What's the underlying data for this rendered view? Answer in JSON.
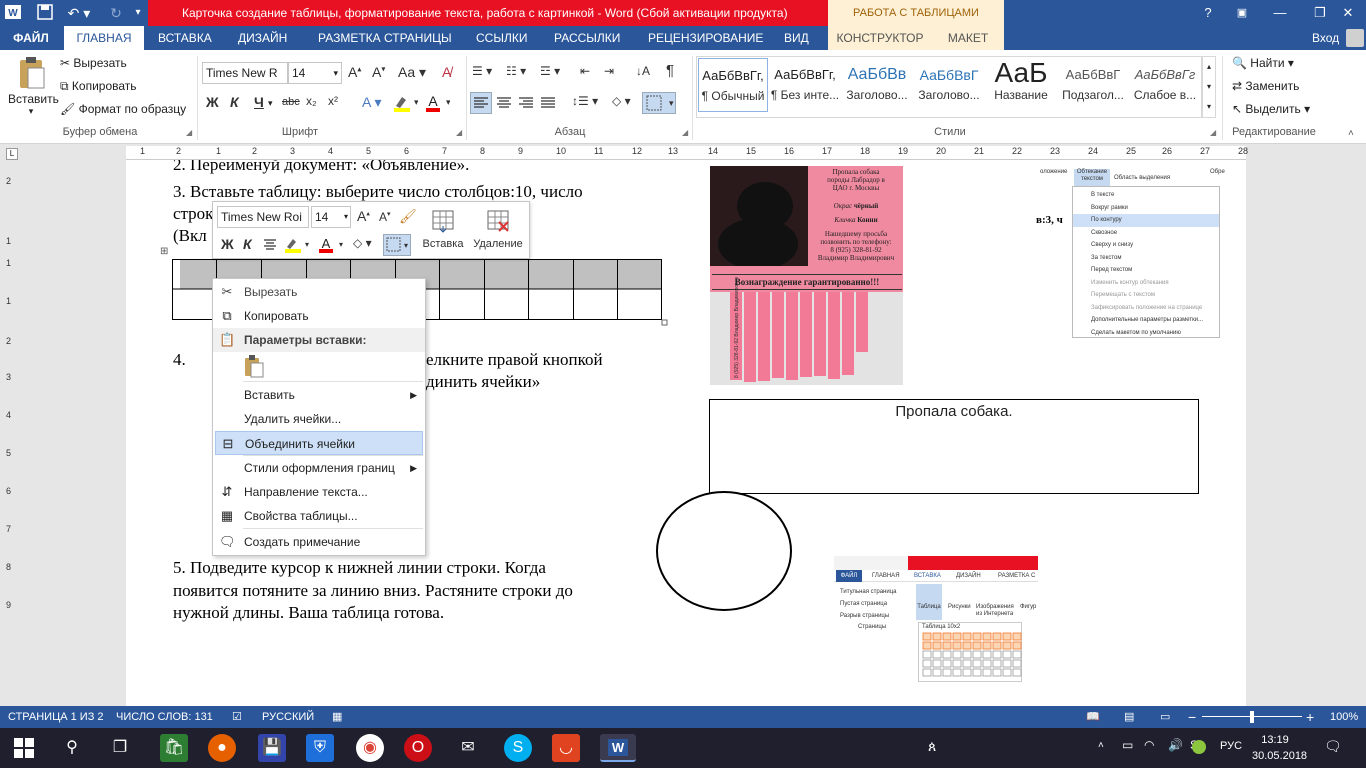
{
  "window": {
    "title": "Карточка создание таблицы, форматирование текста, работа с картинкой -  Word (Сбой активации продукта)",
    "context_tab_group": "РАБОТА С ТАБЛИЦАМИ",
    "login": "Вход",
    "help": "?",
    "minimize": "—",
    "restore": "❐",
    "close": "✕"
  },
  "tabs": [
    "ФАЙЛ",
    "ГЛАВНАЯ",
    "ВСТАВКА",
    "ДИЗАЙН",
    "РАЗМЕТКА СТРАНИЦЫ",
    "ССЫЛКИ",
    "РАССЫЛКИ",
    "РЕЦЕНЗИРОВАНИЕ",
    "ВИД",
    "КОНСТРУКТОР",
    "МАКЕТ"
  ],
  "ribbon": {
    "clipboard": {
      "paste": "Вставить",
      "cut": "Вырезать",
      "copy": "Копировать",
      "format_painter": "Формат по образцу",
      "label": "Буфер обмена"
    },
    "font": {
      "name": "Times New R",
      "size": "14",
      "label": "Шрифт",
      "case": "Aa",
      "bold": "Ж",
      "italic": "К",
      "underline": "Ч",
      "strike": "abc",
      "subscript": "x₂",
      "superscript": "x²"
    },
    "paragraph": {
      "label": "Абзац"
    },
    "styles": {
      "label": "Стили",
      "items": [
        {
          "preview": "АаБбВвГг,",
          "name": "¶ Обычный"
        },
        {
          "preview": "АаБбВвГг,",
          "name": "¶ Без инте..."
        },
        {
          "preview": "АаБбВв",
          "name": "Заголово..."
        },
        {
          "preview": "АаБбВвГ",
          "name": "Заголово..."
        },
        {
          "preview": "АаБ",
          "name": "Название"
        },
        {
          "preview": "АаБбВвГ",
          "name": "Подзагол..."
        },
        {
          "preview": "АаБбВвГг",
          "name": "Слабое в..."
        }
      ]
    },
    "editing": {
      "find": "Найти",
      "replace": "Заменить",
      "select": "Выделить",
      "label": "Редактирование"
    }
  },
  "ruler_numbers": [
    "1",
    "2",
    "1",
    "2",
    "3",
    "4",
    "5",
    "6",
    "7",
    "8",
    "9",
    "10",
    "11",
    "12",
    "13",
    "14",
    "15",
    "16",
    "17",
    "18",
    "19",
    "20",
    "21",
    "22",
    "23",
    "24",
    "25",
    "26",
    "27",
    "28"
  ],
  "vruler_numbers": [
    "2",
    "1",
    "1",
    "1",
    "2",
    "3",
    "4",
    "5",
    "6",
    "7",
    "8",
    "9"
  ],
  "document": {
    "line2": "2.       Переименуй документ: «Объявление».",
    "line3a": "3.       Вставьте таблицу: выберите число столбцов:10, число",
    "line3b": "строк",
    "line3c": "(Вкл",
    "line4a": "4.",
    "line4b": "елкните правой кнопкой",
    "line4c": "динить ячейки»",
    "line5a": "5. Подведите курсор к нижней линии строки.      Когда",
    "line5b": "появится            потяните за линию вниз. Растяните строки до",
    "line5c": "нужной длины. Ваша таблица готова.",
    "textbox": "Пропала собака.",
    "thumb_right_text": "в:3, ч"
  },
  "poster": {
    "title_lines": [
      "Пропала собака",
      "породы Лабрадор в",
      "ЦАО г. Москвы"
    ],
    "okras_label": "Окрас",
    "okras": "чёрный",
    "klichka_label": "Кличка",
    "klichka": "Конни",
    "request": [
      "Нашедшему просьба",
      "позвонить по телефону:",
      "8 (925) 328-81-92",
      "Владимир Владимирович"
    ],
    "reward": "Вознаграждение гарантированно!!!",
    "tab_phone": "8 (925) 328-81-92",
    "tab_name": "Владимир Владимирович"
  },
  "wrap_thumb": {
    "header1": "оложение",
    "header2": "Обтекание текстом",
    "header3": "Область выделения",
    "header4": "Обре",
    "items": [
      "В тексте",
      "Вокруг рамки",
      "По контуру",
      "Сквозное",
      "Сверху и снизу",
      "За текстом",
      "Перед текстом",
      "Изменить контур обтекания",
      "Перемещать с текстом",
      "Зафиксировать положение на странице",
      "Дополнительные параметры разметки...",
      "Сделать макетом по умолчанию"
    ]
  },
  "insert_thumb": {
    "tabs": [
      "ФАЙЛ",
      "ГЛАВНАЯ",
      "ВСТАВКА",
      "ДИЗАЙН",
      "РАЗМЕТКА С"
    ],
    "left_items": [
      "Титульная страница",
      "Пустая страница",
      "Разрыв страницы"
    ],
    "group": "Страницы",
    "buttons": [
      "Таблица",
      "Рисунки",
      "Изображения из Интернета",
      "Фигур"
    ],
    "table_label": "Таблица 10x2"
  },
  "mini_toolbar": {
    "font": "Times New Roi",
    "size": "14",
    "bold": "Ж",
    "italic": "К",
    "insert": "Вставка",
    "delete": "Удаление"
  },
  "context_menu": [
    {
      "label": "Вырезать",
      "icon": "scissors-icon",
      "disabled": true
    },
    {
      "label": "Копировать",
      "icon": "copy-icon"
    },
    {
      "label": "Параметры вставки:",
      "header": true
    },
    {
      "label": "Вставить",
      "submenu": true
    },
    {
      "label": "Удалить ячейки..."
    },
    {
      "label": "Объединить ячейки",
      "icon": "merge-cells-icon",
      "highlight": true
    },
    {
      "label": "Стили оформления границ",
      "submenu": true
    },
    {
      "label": "Направление текста...",
      "icon": "text-direction-icon"
    },
    {
      "label": "Свойства таблицы...",
      "icon": "table-properties-icon"
    },
    {
      "label": "Создать примечание",
      "icon": "comment-icon"
    }
  ],
  "status": {
    "page": "СТРАНИЦА 1 ИЗ 2",
    "words": "ЧИСЛО СЛОВ: 131",
    "language": "РУССКИЙ",
    "zoom": "100%",
    "minus": "−",
    "plus": "+"
  },
  "taskbar": {
    "time": "13:19",
    "date": "30.05.2018",
    "lang": "РУС"
  },
  "colors": {
    "word_blue": "#2b579a",
    "title_red": "#e81123",
    "context_tab": "#fdf0d4",
    "poster_pink": "#f08aa0",
    "menu_highlight": "#cde0f7"
  }
}
